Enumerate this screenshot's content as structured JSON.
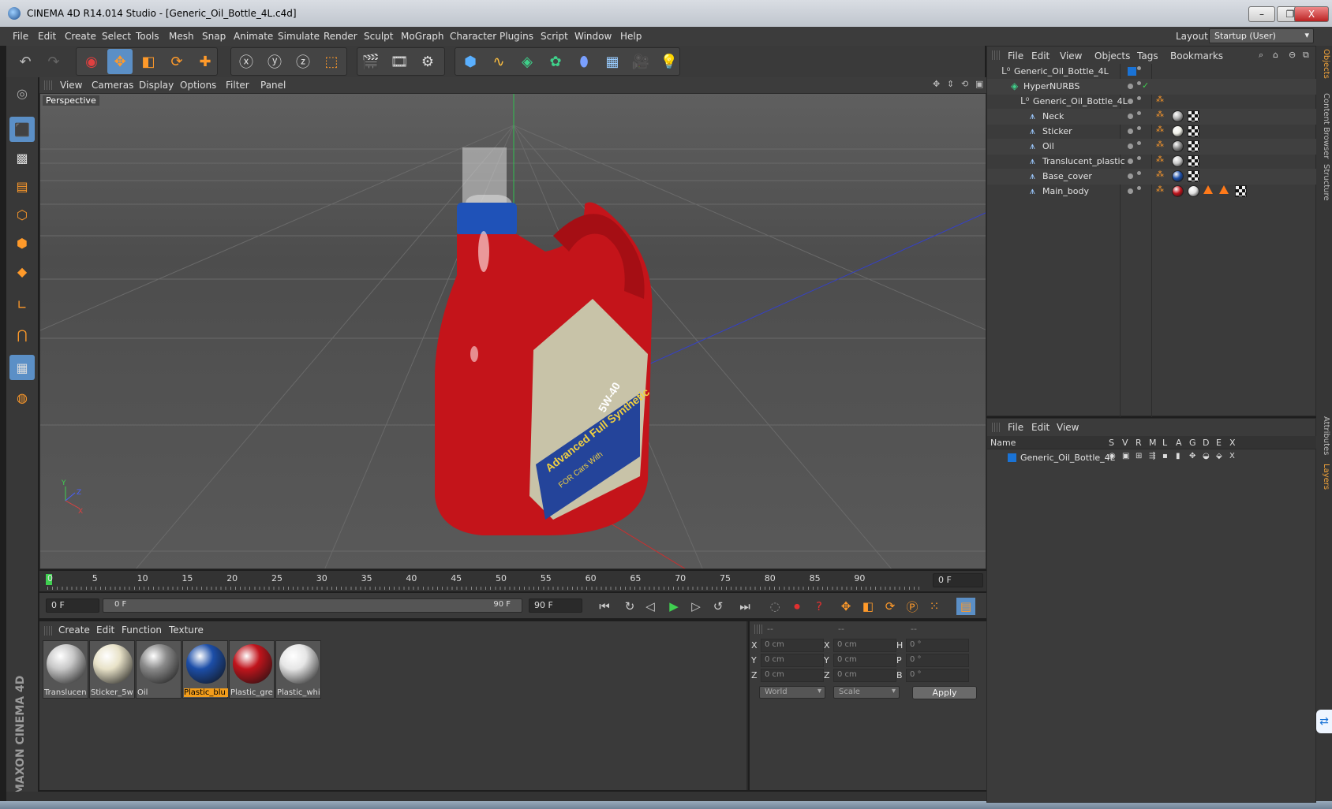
{
  "window": {
    "title": "CINEMA 4D R14.014 Studio - [Generic_Oil_Bottle_4L.c4d]",
    "minimize": "–",
    "restore": "❐",
    "close": "X"
  },
  "menu": [
    "File",
    "Edit",
    "Create",
    "Select",
    "Tools",
    "Mesh",
    "Snap",
    "Animate",
    "Simulate",
    "Render",
    "Sculpt",
    "MoGraph",
    "Character",
    "Plugins",
    "Script",
    "Window",
    "Help"
  ],
  "layout": {
    "label": "Layout:",
    "value": "Startup (User)"
  },
  "viewport": {
    "menu": [
      "View",
      "Cameras",
      "Display",
      "Options",
      "Filter",
      "Panel"
    ],
    "label": "Perspective",
    "axis_y": "Y",
    "axis_z": "Z",
    "axis_x": "X",
    "sticker_line1": "5W-40",
    "sticker_line2": "Advanced Full Synthetic",
    "sticker_line3": "FOR Cars With"
  },
  "timeline": {
    "ticks": [
      "0",
      "5",
      "10",
      "15",
      "20",
      "25",
      "30",
      "35",
      "40",
      "45",
      "50",
      "55",
      "60",
      "65",
      "70",
      "75",
      "80",
      "85",
      "90"
    ],
    "current_frame": "0 F",
    "start_frame": "0 F",
    "range_start": "0 F",
    "range_end": "90 F",
    "end_frame": "90 F"
  },
  "material_panel": {
    "menu": [
      "Create",
      "Edit",
      "Function",
      "Texture"
    ],
    "materials": [
      {
        "name": "Translucen",
        "color": "#c8c8c8"
      },
      {
        "name": "Sticker_5w",
        "color": "#e8e2c8"
      },
      {
        "name": "Oil",
        "color": "#8a8a8a"
      },
      {
        "name": "Plastic_blu",
        "color": "#1c4ea8",
        "selected": true
      },
      {
        "name": "Plastic_gre",
        "color": "#c0141c"
      },
      {
        "name": "Plastic_whi",
        "color": "#e6e6e6"
      }
    ]
  },
  "coordinates": {
    "col_headers": [
      "--",
      "--",
      "--"
    ],
    "rows": [
      {
        "l1": "X",
        "v1": "0 cm",
        "l2": "X",
        "v2": "0 cm",
        "l3": "H",
        "v3": "0 °"
      },
      {
        "l1": "Y",
        "v1": "0 cm",
        "l2": "Y",
        "v2": "0 cm",
        "l3": "P",
        "v3": "0 °"
      },
      {
        "l1": "Z",
        "v1": "0 cm",
        "l2": "Z",
        "v2": "0 cm",
        "l3": "B",
        "v3": "0 °"
      }
    ],
    "mode": "World",
    "scale": "Scale",
    "apply": "Apply"
  },
  "object_manager": {
    "menu": [
      "File",
      "Edit",
      "View",
      "Objects",
      "Tags",
      "Bookmarks"
    ],
    "objects": [
      {
        "name": "Generic_Oil_Bottle_4L",
        "depth": 0
      },
      {
        "name": "HyperNURBS",
        "depth": 1
      },
      {
        "name": "Generic_Oil_Bottle_4L",
        "depth": 2
      },
      {
        "name": "Neck",
        "depth": 3
      },
      {
        "name": "Sticker",
        "depth": 3
      },
      {
        "name": "Oil",
        "depth": 3
      },
      {
        "name": "Translucent_plastic",
        "depth": 3
      },
      {
        "name": "Base_cover",
        "depth": 3
      },
      {
        "name": "Main_body",
        "depth": 3
      }
    ]
  },
  "layer_manager": {
    "menu": [
      "File",
      "Edit",
      "View"
    ],
    "columns": [
      "Name",
      "S",
      "V",
      "R",
      "M",
      "L",
      "A",
      "G",
      "D",
      "E",
      "X"
    ],
    "layers": [
      {
        "name": "Generic_Oil_Bottle_4L",
        "color": "#1a73d6"
      }
    ]
  },
  "side_tabs": [
    "Objects",
    "Content Browser",
    "Structure",
    "Attributes",
    "Layers"
  ],
  "brand": {
    "line1": "MAXON",
    "line2": "CINEMA 4D"
  },
  "colors": {
    "accent": "#5b8fc6",
    "highlight": "#f29d1c",
    "bottle_red": "#c4141a",
    "cap_blue": "#1f52b8"
  }
}
